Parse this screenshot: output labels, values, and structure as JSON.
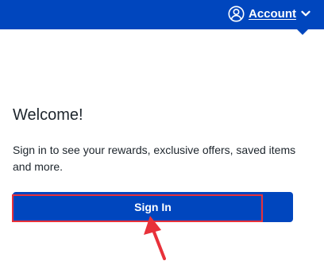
{
  "header": {
    "account_label": "Account",
    "icons": {
      "account": "user-circle-icon",
      "dropdown": "chevron-down-icon"
    },
    "background_color": "#0046be"
  },
  "panel": {
    "title": "Welcome!",
    "description": "Sign in to see your rewards, exclusive offers, saved items and more.",
    "sign_in_label": "Sign In"
  },
  "annotation": {
    "highlight_color": "#e8313a"
  }
}
